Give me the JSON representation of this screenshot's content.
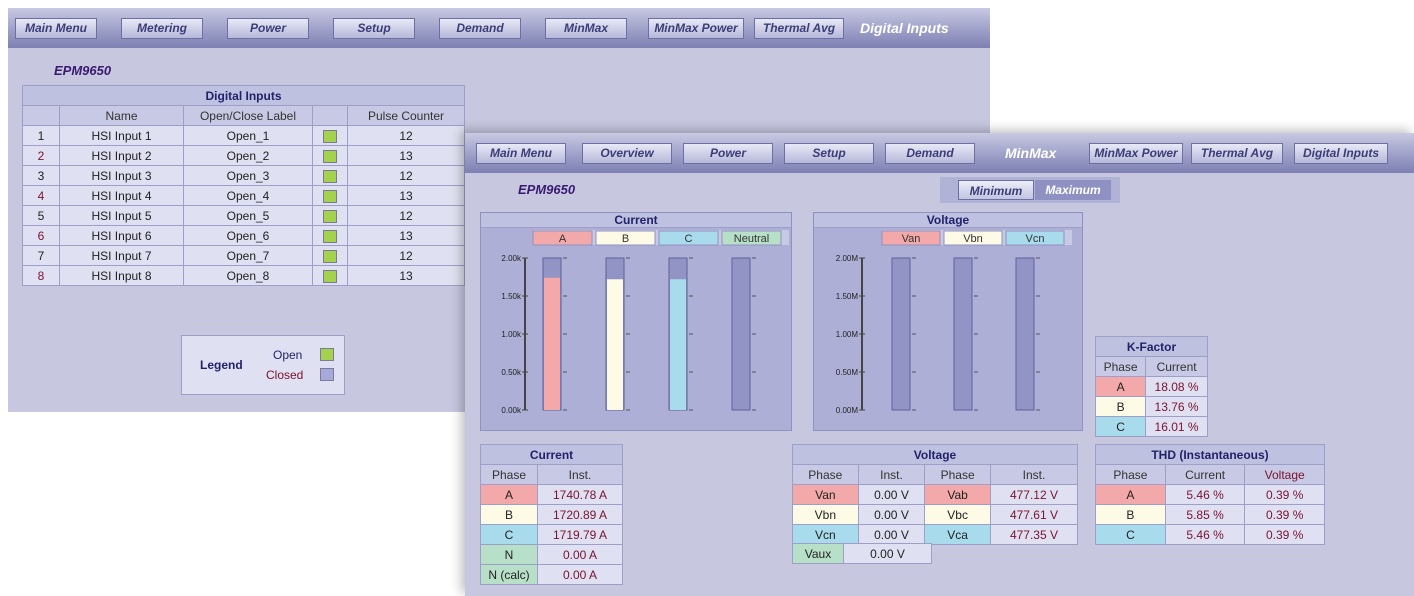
{
  "win1": {
    "nav": [
      "Main Menu",
      "Metering",
      "Power",
      "Setup",
      "Demand",
      "MinMax",
      "MinMax Power",
      "Thermal Avg"
    ],
    "nav_active": "Digital Inputs",
    "device": "EPM9650",
    "table": {
      "title": "Digital Inputs",
      "headers": [
        "Name",
        "Open/Close Label",
        "Pulse Counter"
      ],
      "rows": [
        {
          "idx": "1",
          "name": "HSI Input 1",
          "label": "Open_1",
          "count": "12"
        },
        {
          "idx": "2",
          "name": "HSI Input 2",
          "label": "Open_2",
          "count": "13"
        },
        {
          "idx": "3",
          "name": "HSI Input 3",
          "label": "Open_3",
          "count": "12"
        },
        {
          "idx": "4",
          "name": "HSI Input 4",
          "label": "Open_4",
          "count": "13"
        },
        {
          "idx": "5",
          "name": "HSI Input 5",
          "label": "Open_5",
          "count": "12"
        },
        {
          "idx": "6",
          "name": "HSI Input 6",
          "label": "Open_6",
          "count": "13"
        },
        {
          "idx": "7",
          "name": "HSI Input 7",
          "label": "Open_7",
          "count": "12"
        },
        {
          "idx": "8",
          "name": "HSI Input 8",
          "label": "Open_8",
          "count": "13"
        }
      ]
    },
    "legend": {
      "title": "Legend",
      "open": "Open",
      "closed": "Closed"
    }
  },
  "win2": {
    "nav": [
      "Main Menu",
      "Overview",
      "Power",
      "Setup",
      "Demand"
    ],
    "nav_active": "MinMax",
    "nav_right": [
      "MinMax Power",
      "Thermal Avg",
      "Digital Inputs"
    ],
    "device": "EPM9650",
    "toggle": {
      "minimum": "Minimum",
      "maximum": "Maximum"
    },
    "current_chart": {
      "title": "Current",
      "channels": [
        "A",
        "B",
        "C",
        "Neutral"
      ],
      "yticks": [
        "2.00k",
        "1.50k",
        "1.00k",
        "0.50k",
        "0.00k"
      ],
      "levels": [
        0.87,
        0.86,
        0.86,
        0.0
      ]
    },
    "voltage_chart": {
      "title": "Voltage",
      "channels": [
        "Van",
        "Vbn",
        "Vcn"
      ],
      "yticks": [
        "2.00M",
        "1.50M",
        "1.00M",
        "0.50M",
        "0.00M"
      ],
      "levels": [
        0.0,
        0.0,
        0.0
      ]
    },
    "kfactor": {
      "title": "K-Factor",
      "headers": [
        "Phase",
        "Current"
      ],
      "rows": [
        [
          "A",
          "18.08 %"
        ],
        [
          "B",
          "13.76 %"
        ],
        [
          "C",
          "16.01 %"
        ]
      ]
    },
    "current_table": {
      "title": "Current",
      "headers": [
        "Phase",
        "Inst."
      ],
      "rows": [
        [
          "A",
          "1740.78 A"
        ],
        [
          "B",
          "1720.89 A"
        ],
        [
          "C",
          "1719.79 A"
        ],
        [
          "N",
          "0.00 A"
        ],
        [
          "N (calc)",
          "0.00 A"
        ]
      ]
    },
    "voltage_table": {
      "title": "Voltage",
      "headers": [
        "Phase",
        "Inst.",
        "Phase",
        "Inst."
      ],
      "rows": [
        [
          "Van",
          "0.00 V",
          "Vab",
          "477.12 V"
        ],
        [
          "Vbn",
          "0.00 V",
          "Vbc",
          "477.61 V"
        ],
        [
          "Vcn",
          "0.00 V",
          "Vca",
          "477.35 V"
        ]
      ],
      "aux": [
        "Vaux",
        "0.00 V"
      ]
    },
    "thd": {
      "title": "THD (Instantaneous)",
      "headers": [
        "Phase",
        "Current",
        "Voltage"
      ],
      "rows": [
        [
          "A",
          "5.46 %",
          "0.39 %"
        ],
        [
          "B",
          "5.85 %",
          "0.39 %"
        ],
        [
          "C",
          "5.46 %",
          "0.39 %"
        ]
      ]
    },
    "colors": {
      "A": "#f3a9a9",
      "B": "#fdfbe6",
      "C": "#a8dcec",
      "N": "#b8e0c8",
      "open": "#a4d24c",
      "closed": "#a7a9da"
    }
  }
}
